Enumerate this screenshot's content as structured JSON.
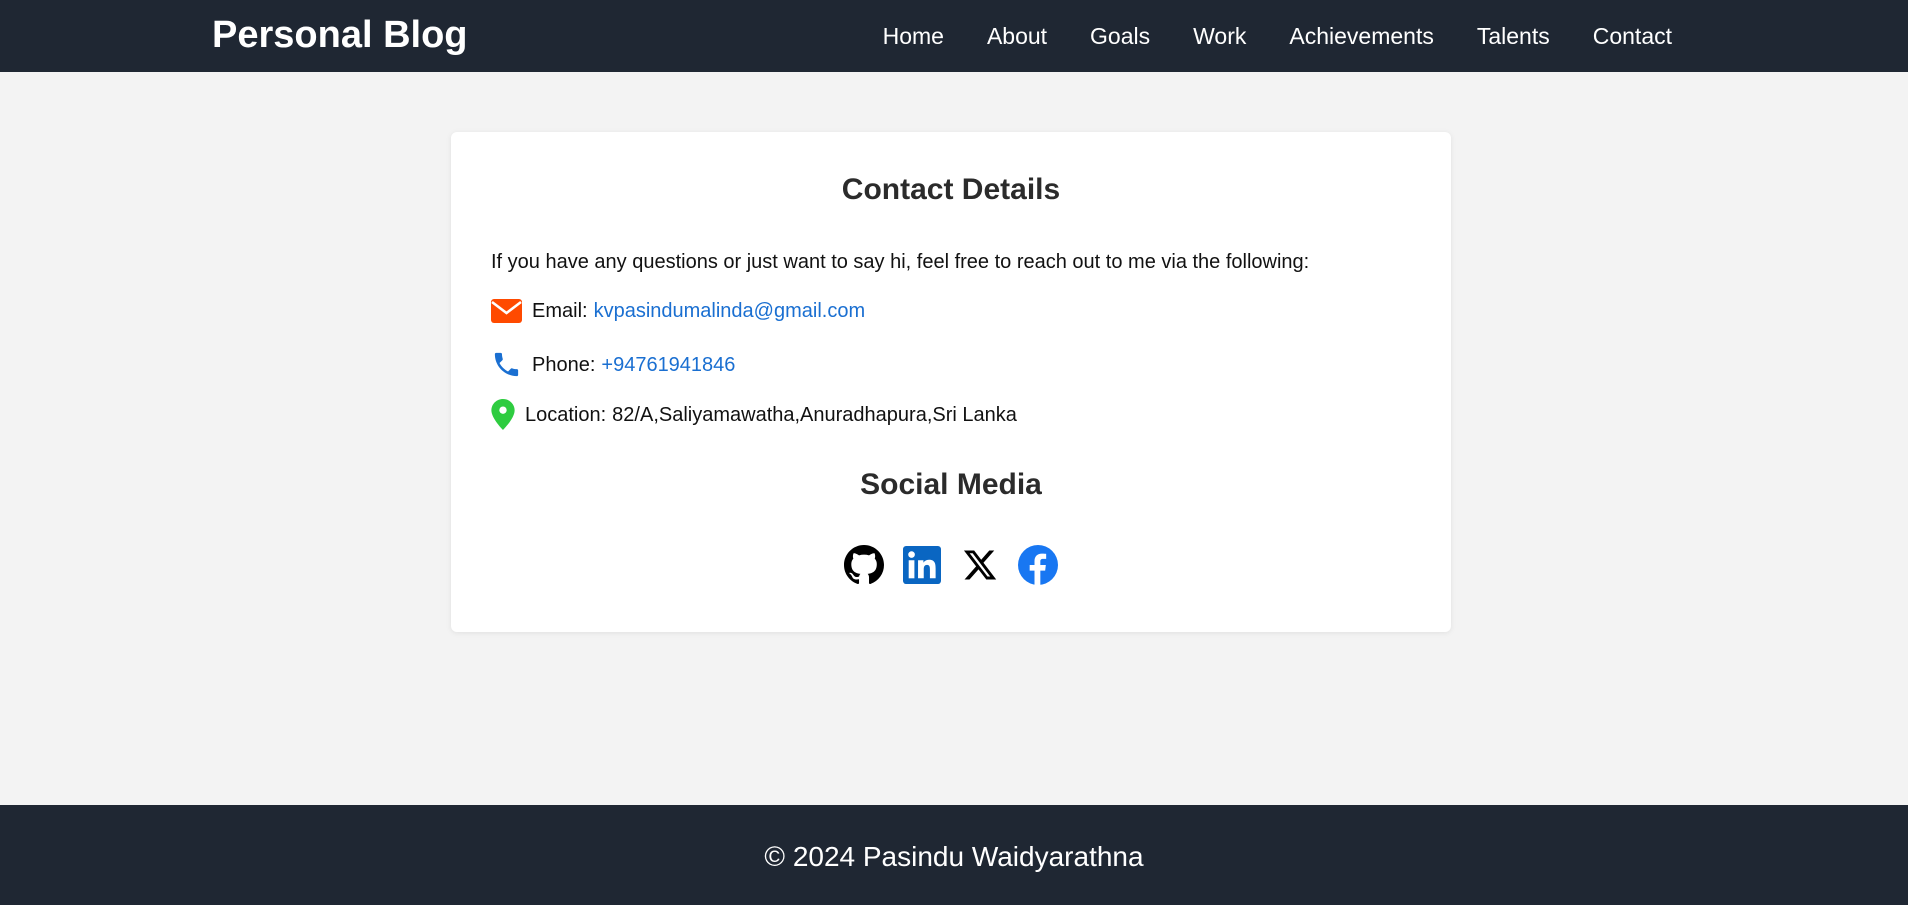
{
  "header": {
    "brand": "Personal Blog",
    "nav": [
      "Home",
      "About",
      "Goals",
      "Work",
      "Achievements",
      "Talents",
      "Contact"
    ]
  },
  "contact": {
    "title": "Contact Details",
    "intro": "If you have any questions or just want to say hi, feel free to reach out to me via the following:",
    "email_label": "Email:",
    "email_value": "kvpasindumalinda@gmail.com",
    "phone_label": "Phone:",
    "phone_value": "+94761941846",
    "location_label": "Location:",
    "location_value": "82/A,Saliyamawatha,Anuradhapura,Sri Lanka",
    "icons": {
      "email": "envelope-icon",
      "phone": "phone-icon",
      "location": "map-pin-icon"
    },
    "colors": {
      "email_icon": "#ff4a00",
      "phone_icon": "#1a6fd1",
      "location_icon": "#2ecc40",
      "link": "#1a6fd1"
    }
  },
  "social": {
    "title": "Social Media",
    "icons": [
      "github-icon",
      "linkedin-icon",
      "x-icon",
      "facebook-icon"
    ],
    "colors": {
      "github": "#000000",
      "linkedin": "#0a66c2",
      "x": "#000000",
      "facebook": "#1877f2"
    }
  },
  "footer": {
    "text": "© 2024 Pasindu Waidyarathna"
  },
  "theme": {
    "header_bg": "#1f2733",
    "page_bg": "#f3f3f3",
    "card_bg": "#ffffff"
  }
}
